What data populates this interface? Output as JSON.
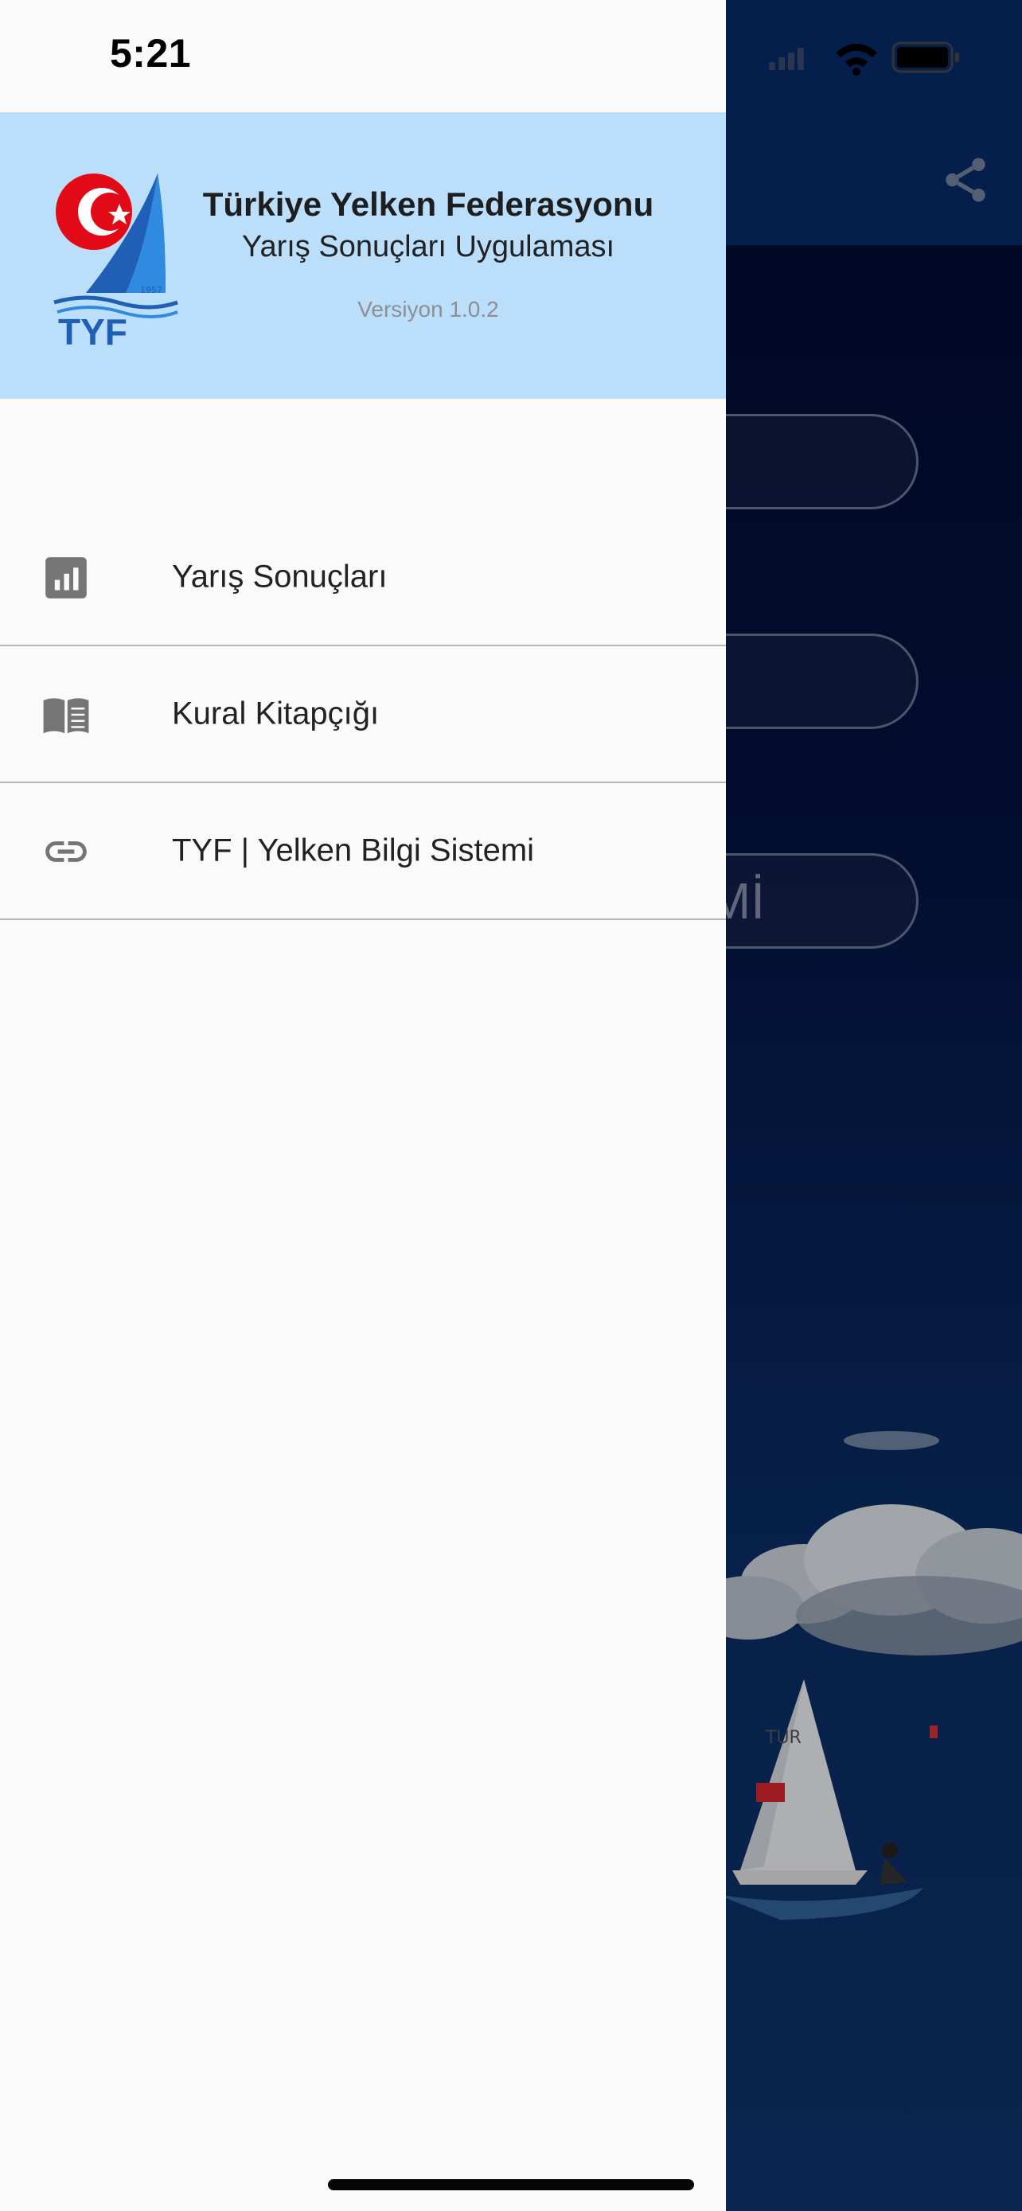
{
  "status_bar": {
    "time": "5:21"
  },
  "drawer": {
    "header": {
      "logo_text": "TYF",
      "logo_year": "1957",
      "title": "Türkiye Yelken Federasyonu",
      "subtitle": "Yarış Sonuçları Uygulaması",
      "version": "Versiyon 1.0.2"
    },
    "menu": [
      {
        "label": "Yarış Sonuçları",
        "icon": "bar-chart-icon"
      },
      {
        "label": "Kural Kitapçığı",
        "icon": "book-icon"
      },
      {
        "label": "TYF | Yelken Bilgi Sistemi",
        "icon": "link-icon"
      }
    ]
  },
  "background_app": {
    "visible_button_text": "Mİ",
    "share_icon": "share-icon"
  },
  "colors": {
    "header_bg": "#bbdefb",
    "drawer_bg": "#fafafa",
    "app_bg": "#041540"
  }
}
